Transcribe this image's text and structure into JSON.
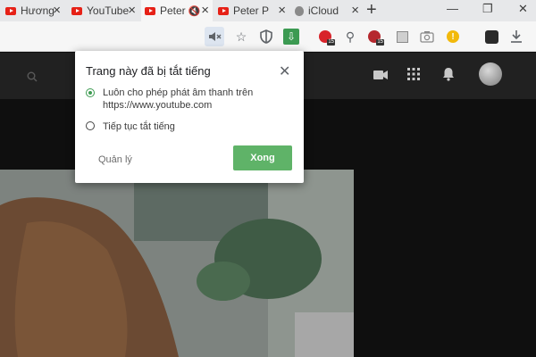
{
  "tabs": [
    {
      "title": "Hương",
      "favicon": "youtube-icon"
    },
    {
      "title": "YouTube",
      "favicon": "youtube-icon"
    },
    {
      "title": "Peter",
      "favicon": "youtube-icon",
      "muted": true
    },
    {
      "title": "Peter P",
      "favicon": "youtube-icon"
    },
    {
      "title": "iCloud",
      "favicon": "apple-icon"
    }
  ],
  "mute_dialog": {
    "title": "Trang này đã bị tắt tiếng",
    "option_allow_line1": "Luôn cho phép phát âm thanh trên",
    "option_allow_line2": "https://www.youtube.com",
    "option_keep_muted": "Tiếp tục tắt tiếng",
    "selected_option": "allow",
    "manage_label": "Quản lý",
    "done_label": "Xong"
  },
  "extension_badges": {
    "badge_1": "15",
    "badge_2": "15"
  },
  "colors": {
    "done_button": "#5fb368",
    "radio_selected": "#3e9b52",
    "youtube_red": "#e62117",
    "tab_strip": "#e7e8ea",
    "youtube_header": "#212121"
  }
}
